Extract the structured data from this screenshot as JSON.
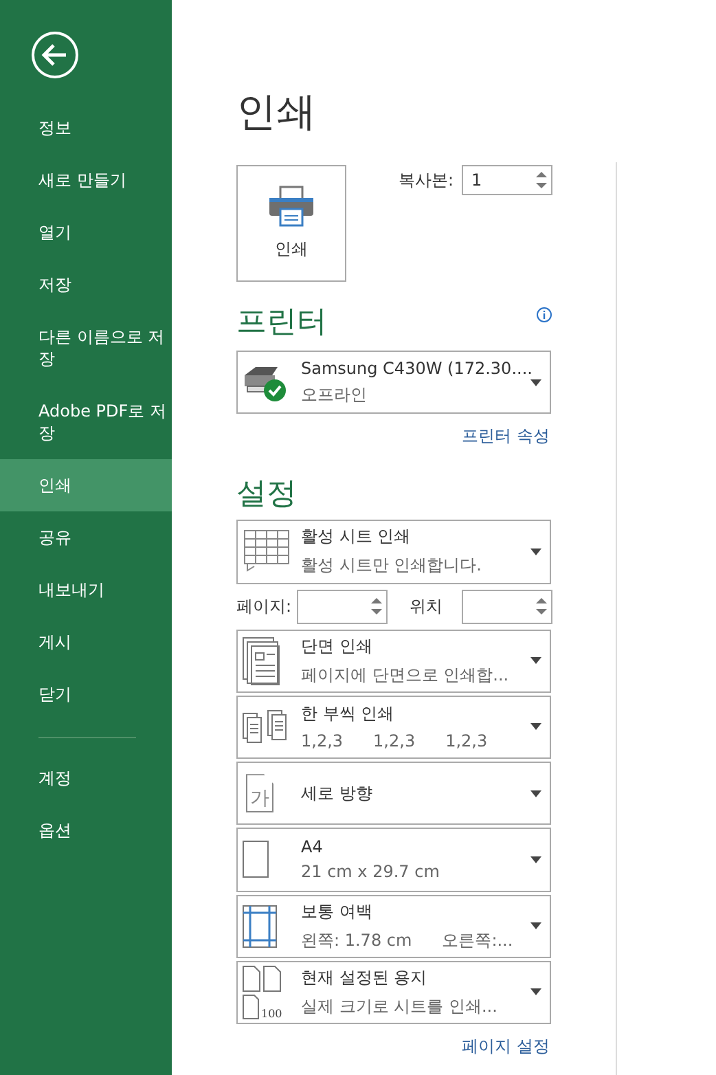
{
  "sidebar": {
    "items": [
      {
        "label": "정보",
        "selected": false
      },
      {
        "label": "새로 만들기",
        "selected": false
      },
      {
        "label": "열기",
        "selected": false
      },
      {
        "label": "저장",
        "selected": false
      },
      {
        "label": "다른 이름으로 저장",
        "selected": false
      },
      {
        "label": "Adobe PDF로 저장",
        "selected": false
      },
      {
        "label": "인쇄",
        "selected": true
      },
      {
        "label": "공유",
        "selected": false
      },
      {
        "label": "내보내기",
        "selected": false
      },
      {
        "label": "게시",
        "selected": false
      },
      {
        "label": "닫기",
        "selected": false
      }
    ],
    "footer_items": [
      {
        "label": "계정",
        "selected": false
      },
      {
        "label": "옵션",
        "selected": false
      }
    ]
  },
  "title": "인쇄",
  "print_button": {
    "label": "인쇄"
  },
  "copies": {
    "label": "복사본:",
    "value": "1"
  },
  "printer": {
    "heading": "프린터",
    "name": "Samsung C430W (172.30....",
    "status": "오프라인",
    "ready": true,
    "link": "프린터 속성"
  },
  "settings": {
    "heading": "설정",
    "items": [
      {
        "kind": "sheet",
        "title": "활성 시트 인쇄",
        "detail": "활성 시트만 인쇄합니다."
      },
      {
        "kind": "pages",
        "page_label": "페이지:",
        "to_label": "위치"
      },
      {
        "kind": "sides",
        "title": "단면 인쇄",
        "detail": "페이지에 단면으로 인쇄합..."
      },
      {
        "kind": "collate",
        "title": "한 부씩 인쇄",
        "details": [
          "1,2,3",
          "1,2,3",
          "1,2,3"
        ]
      },
      {
        "kind": "orientation",
        "title": "세로 방향",
        "icon_text": "가"
      },
      {
        "kind": "paper",
        "title": "A4",
        "detail": "21 cm x 29.7 cm"
      },
      {
        "kind": "margins",
        "title": "보통 여백",
        "details": [
          "왼쪽:  1.78 cm",
          "오른쪽:..."
        ]
      },
      {
        "kind": "scaling",
        "title": "현재 설정된 용지",
        "detail": "실제 크기로 시트를 인쇄...",
        "icon_text": "100"
      }
    ],
    "link": "페이지 설정"
  }
}
